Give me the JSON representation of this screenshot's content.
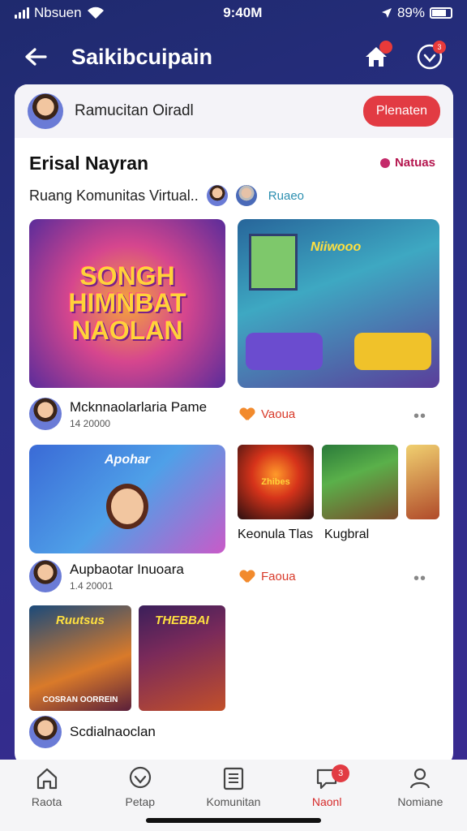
{
  "status_bar": {
    "carrier": "Nbsuen",
    "time": "9:40M",
    "battery": "89%"
  },
  "app_bar": {
    "title": "Saikibcuipain",
    "home_badge": "",
    "notif_badge": "3"
  },
  "profile": {
    "name": "Ramucitan Oiradl",
    "action_label": "Plenaten"
  },
  "section": {
    "title": "Erisal Nayran",
    "link_label": "Natuas",
    "subtitle": "Ruang Komunitas Virtual..",
    "tag": "Ruaeo"
  },
  "feed": {
    "card1": {
      "thumb_text": "SONGH HIMNBAT NAOLAN",
      "thumb2_label": "Niiwooo",
      "author": "Mcknnaolarlaria Pame",
      "author_sub": "14 20000",
      "like_label": "Vaoua"
    },
    "card2": {
      "thumb_label": "Apohar",
      "gallery": [
        "Zhibes",
        "",
        ""
      ],
      "caption1": "Keonula Tlas",
      "caption2": "Kugbral",
      "author": "Aupbaotar Inuoara",
      "author_sub": "1.4 20001",
      "like_label": "Faoua"
    },
    "card3": {
      "thumb_a_top": "Ruutsus",
      "thumb_a_bottom": "COSRAN OORREIN",
      "thumb_b_top": "THEBBAI",
      "author": "Scdialnaoclan"
    }
  },
  "bottom_nav": {
    "items": [
      {
        "label": "Raota",
        "icon": "home-icon"
      },
      {
        "label": "Petap",
        "icon": "heart-chat-icon"
      },
      {
        "label": "Komunitan",
        "icon": "list-icon"
      },
      {
        "label": "Naonl",
        "icon": "message-icon",
        "badge": "3"
      },
      {
        "label": "Nomiane",
        "icon": "profile-icon"
      }
    ],
    "active_index": 3
  },
  "colors": {
    "accent": "#e23b43",
    "background_top": "#1f2a6e",
    "card": "#ffffff"
  }
}
